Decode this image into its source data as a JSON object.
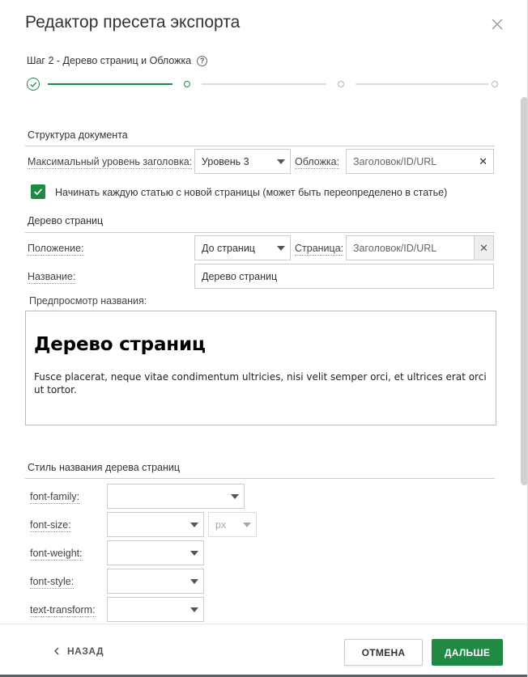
{
  "dialog": {
    "title": "Редактор пресета экспорта"
  },
  "step": {
    "title": "Шаг 2 - Дерево страниц и Обложка",
    "help_icon": "?",
    "current": 2,
    "total": 4
  },
  "structure": {
    "section_title": "Структура документа",
    "max_heading_label": "Максимальный уровень заголовка:",
    "max_heading_value": "Уровень 3",
    "cover_label": "Обложка:",
    "cover_placeholder": "Заголовок/ID/URL",
    "new_page_checkbox_label": "Начинать каждую статью с новой страницы (может быть переопределено в статье)",
    "new_page_checked": true
  },
  "page_tree": {
    "section_title": "Дерево страниц",
    "position_label": "Положение:",
    "position_value": "До страниц",
    "page_label": "Страница:",
    "page_placeholder": "Заголовок/ID/URL",
    "name_label": "Название:",
    "name_value": "Дерево страниц",
    "preview_label": "Предпросмотр названия:",
    "preview_heading": "Дерево страниц",
    "preview_text": "Fusce placerat, neque vitae condimentum ultricies, nisi velit semper orci, et ultrices erat orci ut tortor."
  },
  "style": {
    "section_title": "Стиль названия дерева страниц",
    "font_family_label": "font-family:",
    "font_size_label": "font-size:",
    "font_size_unit": "px",
    "font_weight_label": "font-weight:",
    "font_style_label": "font-style:",
    "text_transform_label": "text-transform:"
  },
  "footer": {
    "back_label": "НАЗАД",
    "cancel_label": "ОТМЕНА",
    "next_label": "ДАЛЬШЕ"
  },
  "colors": {
    "accent": "#1e8a44",
    "stepper_inactive": "#cccccc"
  }
}
